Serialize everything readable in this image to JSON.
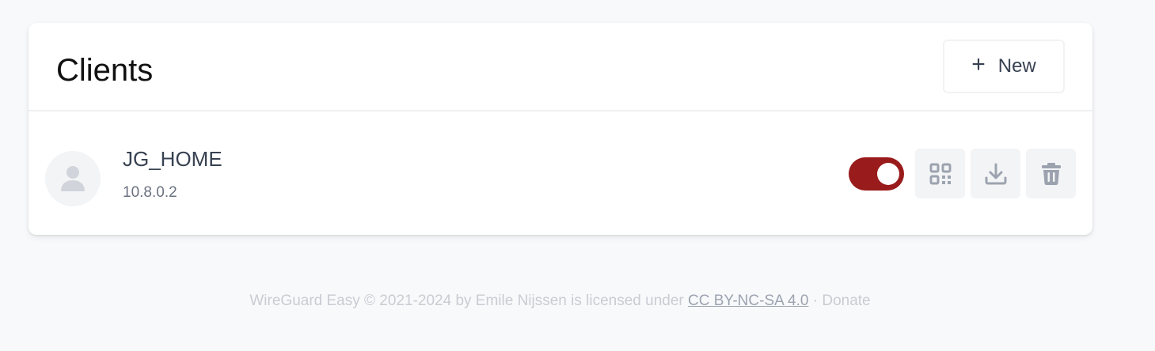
{
  "header": {
    "title": "Clients",
    "new_button": {
      "icon": "plus-icon",
      "plus_glyph": "+",
      "label": "New"
    }
  },
  "clients": [
    {
      "name": "JG_HOME",
      "address": "10.8.0.2",
      "enabled": true,
      "actions": [
        "qr-code-icon",
        "download-icon",
        "trash-icon"
      ]
    }
  ],
  "footer": {
    "text_prefix": "WireGuard Easy © 2021-2024 by Emile Nijssen is licensed under ",
    "license_link": "CC BY-NC-SA 4.0",
    "separator": " · ",
    "donate": "Donate"
  },
  "colors": {
    "toggle_on": "#991b1b",
    "page_bg": "#f8f9fb",
    "icon_gray": "#9ca3af"
  }
}
